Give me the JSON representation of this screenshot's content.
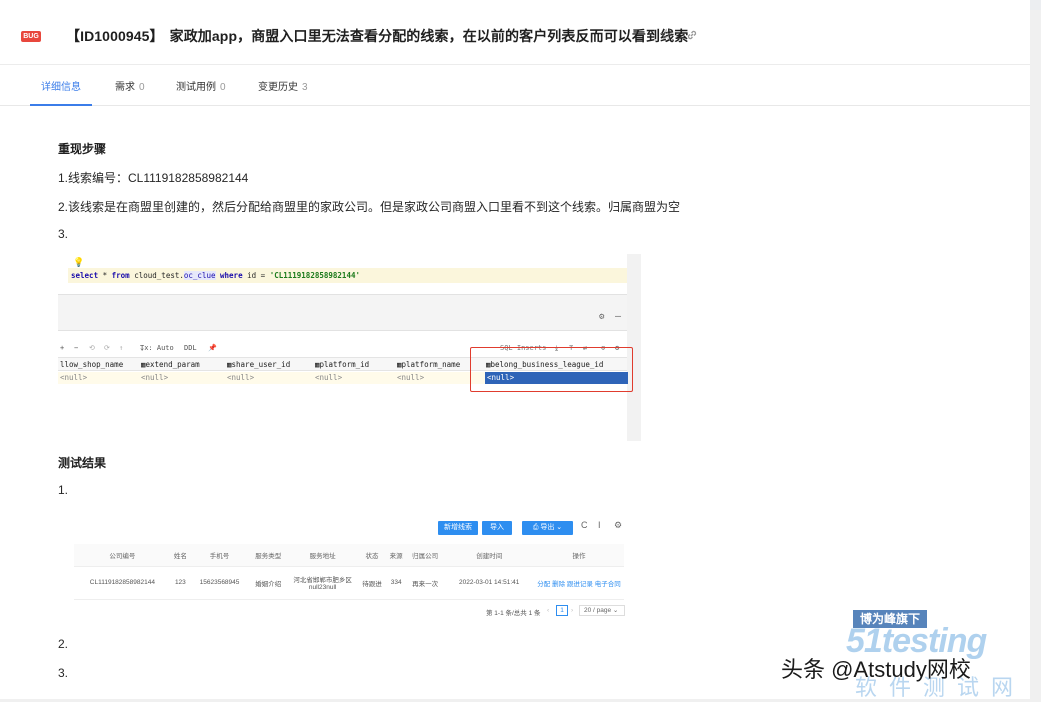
{
  "header": {
    "bug_tag": "BUG",
    "id": "【ID1000945】",
    "title": "家政加app，商盟入口里无法查看分配的线索，在以前的客户列表反而可以看到线索"
  },
  "tabs": [
    {
      "label": "详细信息",
      "count": ""
    },
    {
      "label": "需求",
      "count": "0"
    },
    {
      "label": "测试用例",
      "count": "0"
    },
    {
      "label": "变更历史",
      "count": "3"
    }
  ],
  "content": {
    "repro_heading": "重现步骤",
    "step1": "1.线索编号：CL1119182858982144",
    "step2": "2.该线索是在商盟里创建的，然后分配给商盟里的家政公司。但是家政公司商盟入口里看不到这个线索。归属商盟为空",
    "step3": "3.",
    "result_heading": "测试结果",
    "r1": "1.",
    "r2": "2.",
    "r3": "3."
  },
  "sql": {
    "kw_select": "select",
    "star_from": " * ",
    "kw_from": "from",
    "table_prefix": " cloud_test.",
    "table": "oc_clue",
    "kw_where": " where",
    "cond": " id = ",
    "value": "'CL1119182858982144'",
    "tx": "Tx: Auto",
    "ddl": "DDL",
    "sql_inserts": "SQL Inserts",
    "columns": [
      "llow_shop_name",
      "extend_param",
      "share_user_id",
      "platform_id",
      "platform_name",
      "belong_business_league_id"
    ],
    "row": [
      "<null>",
      "<null>",
      "<null>",
      "<null>",
      "<null>",
      "<null>"
    ]
  },
  "result": {
    "buttons": [
      "新增线索",
      "导入",
      "导出"
    ],
    "headers": [
      "公司编号",
      "姓名",
      "手机号",
      "服务类型",
      "服务地址",
      "状态",
      "来源",
      "归属公司",
      "创建时间",
      "操作"
    ],
    "row": [
      "CL1119182858982144",
      "123",
      "15623568945",
      "婚姻介绍",
      "河北省邯郸市肥乡区null23null",
      "待跟进",
      "334",
      "再来一次",
      "2022-03-01 14:51:41",
      "分配 删除 跟进记录 电子合同"
    ],
    "pager_text": "第 1-1 条/总共 1 条",
    "current_page": "1",
    "page_size": "20 / page"
  },
  "watermark": {
    "badge": "博为峰旗下",
    "brand": "51testing",
    "cn": "软件测试网",
    "author": "头条 @Atstudy网校"
  }
}
